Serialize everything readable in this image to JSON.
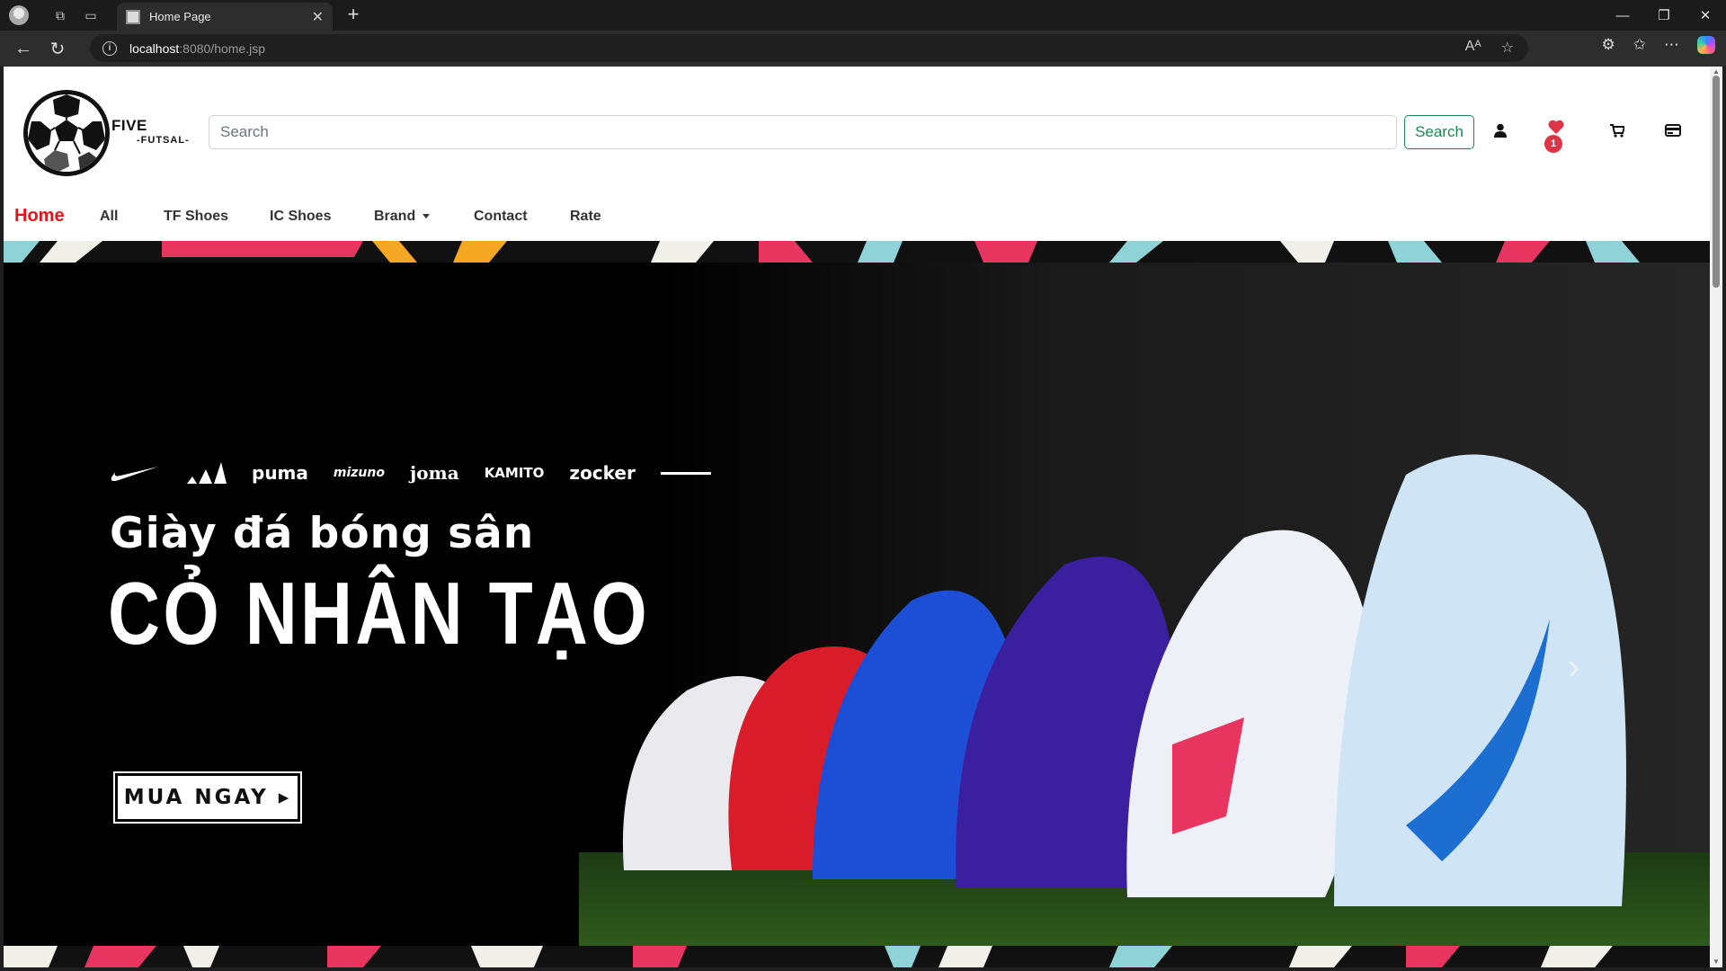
{
  "browser": {
    "tab_title": "Home Page",
    "url_host": "localhost",
    "url_path": ":8080/home.jsp"
  },
  "header": {
    "brand_name": "FIVE",
    "brand_sub": "-FUTSAL-",
    "search_placeholder": "Search",
    "search_button": "Search",
    "wishlist_count": "1",
    "icons": [
      "user-icon",
      "heart-icon",
      "cart-icon",
      "menu-card-icon"
    ]
  },
  "nav": {
    "items": [
      {
        "label": "Home",
        "active": true
      },
      {
        "label": "All"
      },
      {
        "label": "TF Shoes"
      },
      {
        "label": "IC Shoes"
      },
      {
        "label": "Brand"
      },
      {
        "label": "Contact"
      },
      {
        "label": "Rate"
      }
    ]
  },
  "banner": {
    "brands": [
      "puma",
      "mizuno",
      "joma",
      "KAMITO",
      "zocker"
    ],
    "subtitle": "Giày đá bóng sân",
    "title": "CỎ NHÂN TẠO",
    "cta": "MUA NGAY ▸"
  },
  "colors": {
    "accent_red": "#e5141a",
    "search_green": "#198754",
    "badge_red": "#dc3545"
  }
}
